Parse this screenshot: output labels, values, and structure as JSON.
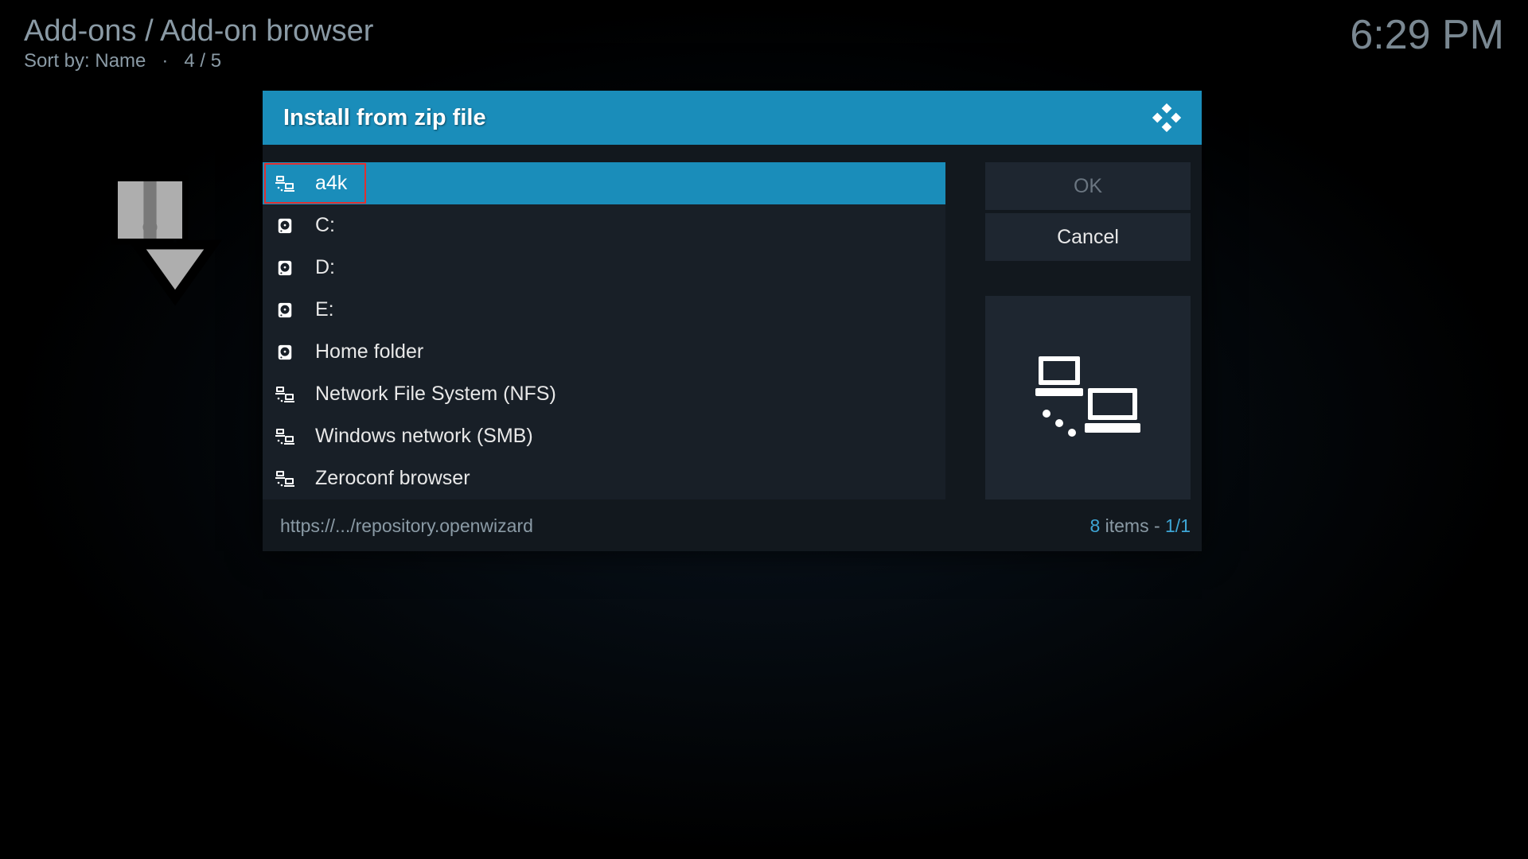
{
  "header": {
    "breadcrumb": "Add-ons / Add-on browser",
    "sort_label": "Sort by: Name",
    "position": "4 / 5",
    "clock": "6:29 PM"
  },
  "dialog": {
    "title": "Install from zip file",
    "items": [
      {
        "label": "a4k",
        "icon": "network",
        "selected": true,
        "highlight": true
      },
      {
        "label": "C:",
        "icon": "drive"
      },
      {
        "label": "D:",
        "icon": "drive"
      },
      {
        "label": "E:",
        "icon": "drive"
      },
      {
        "label": "Home folder",
        "icon": "drive"
      },
      {
        "label": "Network File System (NFS)",
        "icon": "network"
      },
      {
        "label": "Windows network (SMB)",
        "icon": "network"
      },
      {
        "label": "Zeroconf browser",
        "icon": "network"
      }
    ],
    "buttons": {
      "ok": "OK",
      "cancel": "Cancel"
    },
    "footer_path": "https://.../repository.openwizard",
    "footer_count_num": "8",
    "footer_count_rest": " items - ",
    "footer_page": "1/1"
  }
}
